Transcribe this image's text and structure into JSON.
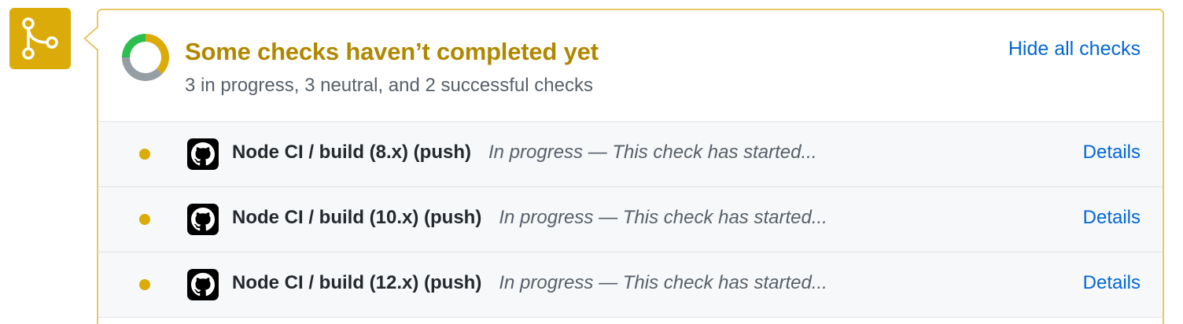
{
  "summary": {
    "title": "Some checks haven’t completed yet",
    "subtitle": "3 in progress, 3 neutral, and 2 successful checks",
    "toggle_label": "Hide all checks",
    "counts": {
      "in_progress": 3,
      "neutral": 3,
      "successful": 2
    },
    "status_colors": {
      "pending": "#dbab09",
      "neutral": "#959da5",
      "success": "#2cbe4e"
    }
  },
  "badge": {
    "icon": "git-merge-icon",
    "color": "#dbab09"
  },
  "checks": [
    {
      "name": "Node CI / build (8.x) (push)",
      "description": "In progress — This check has started...",
      "status": "in_progress",
      "app_icon": "github-icon",
      "details_label": "Details"
    },
    {
      "name": "Node CI / build (10.x) (push)",
      "description": "In progress — This check has started...",
      "status": "in_progress",
      "app_icon": "github-icon",
      "details_label": "Details"
    },
    {
      "name": "Node CI / build (12.x) (push)",
      "description": "In progress — This check has started...",
      "status": "in_progress",
      "app_icon": "github-icon",
      "details_label": "Details"
    }
  ]
}
